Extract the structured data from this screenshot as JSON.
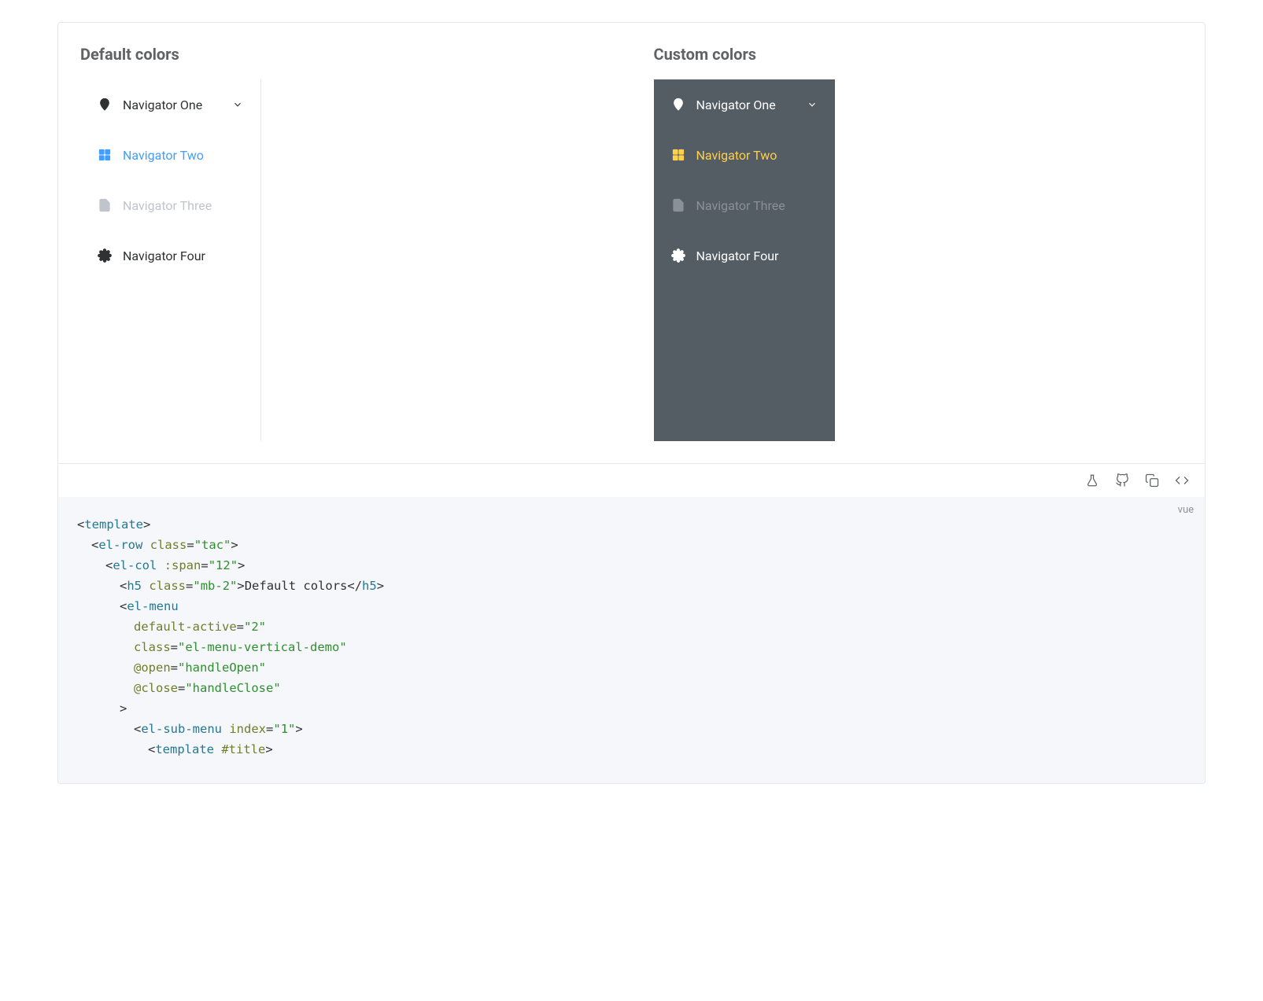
{
  "default_colors_heading": "Default colors",
  "custom_colors_heading": "Custom colors",
  "menu": {
    "one": "Navigator One",
    "two": "Navigator Two",
    "three": "Navigator Three",
    "four": "Navigator Four"
  },
  "code_lang": "vue",
  "code": {
    "l1": {
      "t1": "template"
    },
    "l2": {
      "t1": "el-row",
      "a1": "class",
      "v1": "\"tac\""
    },
    "l3": {
      "t1": "el-col",
      "a1": ":span",
      "v1": "\"12\""
    },
    "l4": {
      "t1": "h5",
      "a1": "class",
      "v1": "\"mb-2\"",
      "txt": "Default colors",
      "t2": "h5"
    },
    "l5": {
      "t1": "el-menu"
    },
    "l6": {
      "a1": "default-active",
      "v1": "\"2\""
    },
    "l7": {
      "a1": "class",
      "v1": "\"el-menu-vertical-demo\""
    },
    "l8": {
      "a1": "@open",
      "v1": "\"handleOpen\""
    },
    "l9": {
      "a1": "@close",
      "v1": "\"handleClose\""
    },
    "l10": {
      "t1": "el-sub-menu",
      "a1": "index",
      "v1": "\"1\""
    },
    "l11": {
      "t1": "template",
      "a1": "#title"
    }
  }
}
